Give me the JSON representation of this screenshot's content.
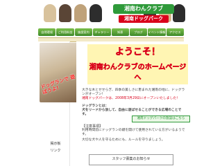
{
  "header": {
    "logo_title": "湘南わんクラブ",
    "logo_subtitle": "湘南ドッグパーク"
  },
  "nav": {
    "items": [
      "自然環境",
      "ご利用料金",
      "施設案内",
      "ギャラリー",
      "知恵",
      "ブログ",
      "イベント情報",
      "アクセス"
    ]
  },
  "sidebar": {
    "promo_text": "ドッグランで\n遊ぼうよ!",
    "item_1": "掲示板",
    "item_2": "リンク"
  },
  "welcome": {
    "line1": "ようこそ！",
    "line2": "湘南わんクラブのホームページへ"
  },
  "content": {
    "p1": "大きな木とせせらぎ、四季の美しさに恵まれた湘南の地に、ドッグランがオープン！",
    "p2": "湘南ドッグパークは、2008年3月29日にオープンいたしました！",
    "p3": "ドッグランとは：",
    "p4": "犬をリードから放して、自由に遊ばせることができる広場のことです。",
    "link_label": "湘南ドッグパークの施設はこちら"
  },
  "notice": {
    "title": "【注意事項】",
    "text1": "利用時間前にドッグランの鍵を開けて使用されている方がいるようです。",
    "text2": "大切な犬や人を守るためにも、ルールを守りましょう。"
  },
  "staff_box": {
    "title": "スタッフ募集のお知らせ"
  },
  "colors": {
    "accent_green": "#2f9a3a",
    "accent_red": "#d9001b",
    "welcome_yellow": "#ffd400",
    "welcome_bg": "#fff5b3"
  }
}
